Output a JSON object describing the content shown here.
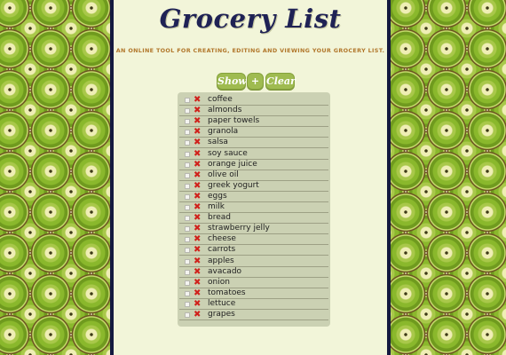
{
  "header": {
    "title": "Grocery List",
    "subtitle": "AN ONLINE TOOL FOR CREATING, EDITING AND VIEWING YOUR GROCERY LIST."
  },
  "toolbar": {
    "show_label": "Show",
    "add_label": "+",
    "clear_label": "Clear"
  },
  "items": [
    "coffee",
    "almonds",
    "paper towels",
    "granola",
    "salsa",
    "soy sauce",
    "orange juice",
    "olive oil",
    "greek yogurt",
    "eggs",
    "milk",
    "bread",
    "strawberry jelly",
    "cheese",
    "carrots",
    "apples",
    "avacado",
    "onion",
    "tomatoes",
    "lettuce",
    "grapes"
  ],
  "icons": {
    "delete": "close-icon",
    "checkbox": "checkbox-icon"
  },
  "colors": {
    "panel_border": "#14193f",
    "title": "#1f2255",
    "subtitle": "#b1762a",
    "button": "#9fbb50",
    "delete": "#d0211b"
  }
}
